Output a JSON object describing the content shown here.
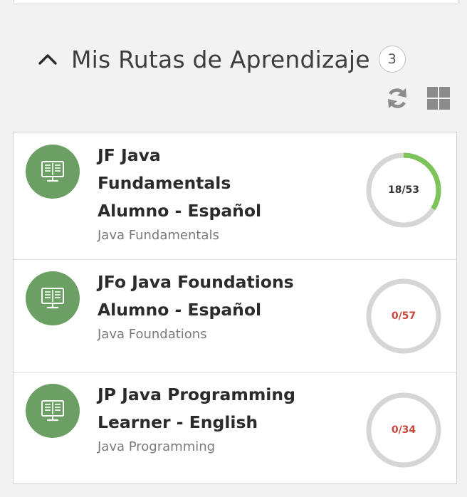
{
  "section": {
    "title": "Mis Rutas de Aprendizaje",
    "count": "3"
  },
  "toolbar": {
    "refresh_icon": "refresh-icon",
    "grid_icon": "grid-view-icon"
  },
  "colors": {
    "icon_bg": "#6c9f64",
    "progress_track": "#d6d6d6",
    "progress_fill": "#7cc35a",
    "zero_progress_text": "#c8473d"
  },
  "paths": [
    {
      "title_lines": [
        "JF Java",
        "Fundamentals",
        "Alumno - Español"
      ],
      "subtitle": "Java Fundamentals",
      "progress_label": "18/53",
      "completed": 18,
      "total": 53,
      "icon": "book-monitor-icon"
    },
    {
      "title_lines": [
        "JFo Java Foundations",
        "Alumno - Español"
      ],
      "subtitle": "Java Foundations",
      "progress_label": "0/57",
      "completed": 0,
      "total": 57,
      "icon": "book-monitor-icon"
    },
    {
      "title_lines": [
        "JP Java Programming",
        "Learner - English"
      ],
      "subtitle": "Java Programming",
      "progress_label": "0/34",
      "completed": 0,
      "total": 34,
      "icon": "book-monitor-icon"
    }
  ]
}
